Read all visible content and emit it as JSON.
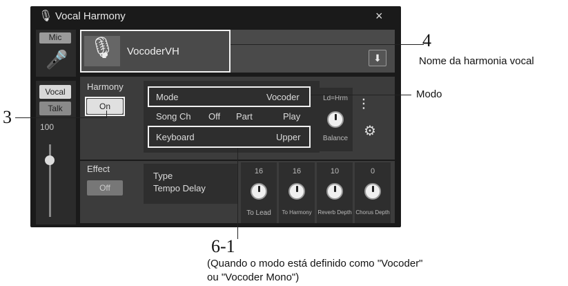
{
  "window": {
    "title": "Vocal Harmony",
    "close_icon": "×",
    "title_icon": "mic-note-icon"
  },
  "left": {
    "mic_label": "Mic",
    "vocal_label": "Vocal",
    "talk_label": "Talk",
    "volume": "100"
  },
  "preset": {
    "name": "VocoderVH",
    "save_icon": "save-icon"
  },
  "harmony": {
    "label": "Harmony",
    "toggle": "On",
    "mode_label": "Mode",
    "mode_value": "Vocoder",
    "songch_label": "Song Ch",
    "songch_value": "Off",
    "part_label": "Part",
    "part_value": "Play",
    "keyboard_label": "Keyboard",
    "keyboard_value": "Upper",
    "ld_label": "Ld=Hrm",
    "balance_label": "Balance"
  },
  "effect": {
    "label": "Effect",
    "toggle": "Off",
    "type_label": "Type",
    "type_value": "Tempo Delay",
    "knobs": [
      {
        "value": "16",
        "label": "To Lead"
      },
      {
        "value": "16",
        "label": "To Harmony"
      },
      {
        "value": "10",
        "label": "Reverb Depth"
      },
      {
        "value": "0",
        "label": "Chorus Depth"
      }
    ]
  },
  "callouts": {
    "n4": "4",
    "n4_text": "Nome da harmonia vocal",
    "modo": "Modo",
    "n3": "3",
    "n61": "6-1",
    "n61_line1": "(Quando o modo está definido como \"Vocoder\"",
    "n61_line2": "ou \"Vocoder Mono\")"
  }
}
